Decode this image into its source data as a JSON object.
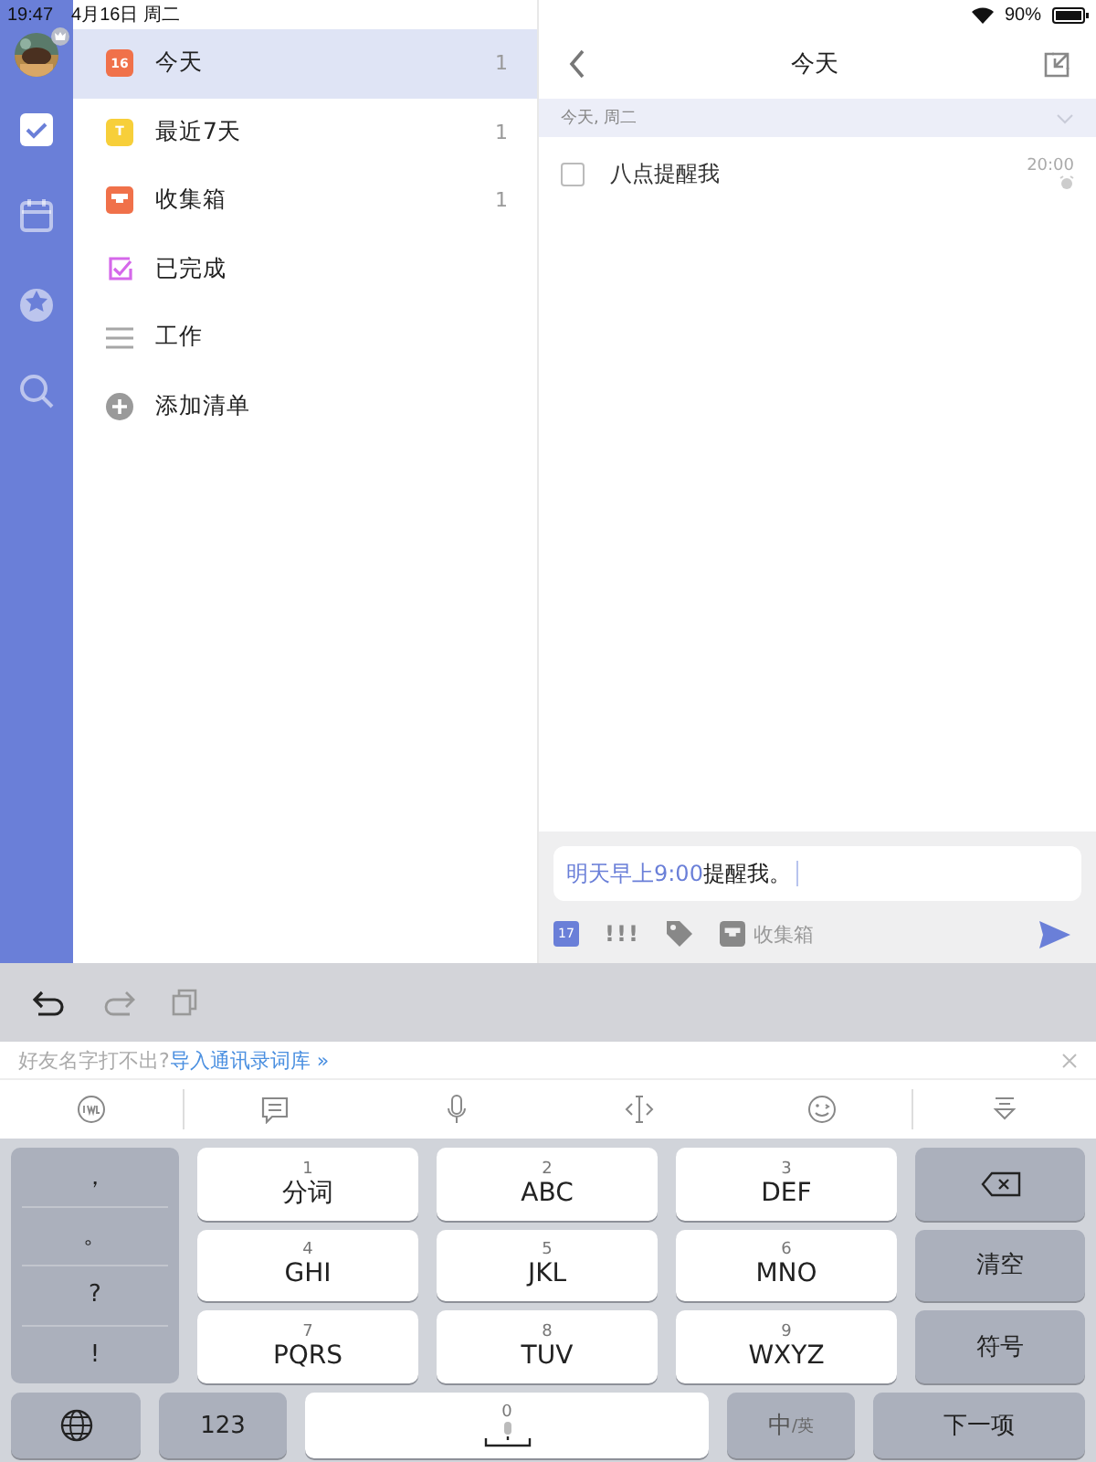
{
  "status_bar": {
    "time": "19:47",
    "date": "4月16日 周二",
    "battery": "90%"
  },
  "rail_items": [
    {
      "kind": "tasks",
      "selected": true
    },
    {
      "kind": "calendar",
      "selected": false
    },
    {
      "kind": "badge",
      "selected": false
    },
    {
      "kind": "search",
      "selected": false
    }
  ],
  "lists": [
    {
      "kind": "today",
      "label": "今天",
      "icon_text": "16",
      "count": "1",
      "selected": true
    },
    {
      "kind": "week",
      "label": "最近7天",
      "icon_text": "T",
      "count": "1",
      "selected": false
    },
    {
      "kind": "inbox",
      "label": "收集箱",
      "count": "1",
      "selected": false
    },
    {
      "kind": "done",
      "label": "已完成",
      "selected": false
    },
    {
      "kind": "list",
      "label": "工作",
      "selected": false
    },
    {
      "kind": "add",
      "label": "添加清单",
      "selected": false
    }
  ],
  "detail": {
    "title": "今天",
    "section": "今天, 周二",
    "tasks": [
      {
        "title": "八点提醒我",
        "time": "20:00",
        "checked": false,
        "alarm": true
      }
    ]
  },
  "composer": {
    "highlight": "明天早上9:00",
    "text": "提醒我。",
    "date_badge": "17",
    "priority": "!!!",
    "list": "收集箱"
  },
  "keyboard": {
    "suggestion": {
      "hint": "好友名字打不出?",
      "link": "导入通讯录词库 »"
    },
    "punctuation": [
      "，",
      "。",
      "?",
      "!"
    ],
    "keys": [
      {
        "digit": "1",
        "label": "分词"
      },
      {
        "digit": "2",
        "label": "ABC"
      },
      {
        "digit": "3",
        "label": "DEF"
      },
      {
        "digit": "4",
        "label": "GHI"
      },
      {
        "digit": "5",
        "label": "JKL"
      },
      {
        "digit": "6",
        "label": "MNO"
      },
      {
        "digit": "7",
        "label": "PQRS"
      },
      {
        "digit": "8",
        "label": "TUV"
      },
      {
        "digit": "9",
        "label": "WXYZ"
      }
    ],
    "side_keys": [
      {
        "kind": "delete"
      },
      {
        "kind": "text",
        "label": "清空"
      },
      {
        "kind": "text",
        "label": "符号"
      }
    ],
    "bottom": [
      {
        "kind": "globe"
      },
      {
        "kind": "text",
        "label": "123"
      },
      {
        "kind": "space",
        "digit": "0"
      },
      {
        "kind": "lang",
        "label": "中",
        "sub": "/英"
      },
      {
        "kind": "text",
        "label": "下一项"
      }
    ]
  }
}
